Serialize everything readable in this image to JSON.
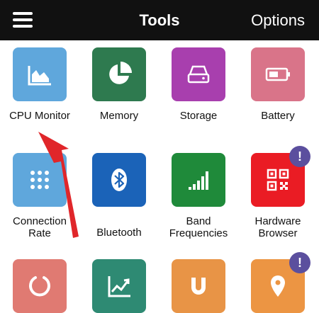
{
  "topbar": {
    "title": "Tools",
    "options_label": "Options"
  },
  "colors": {
    "topbar_bg": "#111111",
    "badge": "#5b4f9e",
    "arrow": "#e0262a"
  },
  "tiles": [
    {
      "label": "CPU Monitor",
      "icon": "area-chart-icon",
      "color": "#5fa7dc",
      "badge": ""
    },
    {
      "label": "Memory",
      "icon": "pie-chart-icon",
      "color": "#2e7a4f",
      "badge": ""
    },
    {
      "label": "Storage",
      "icon": "hard-drive-icon",
      "color": "#a83fae",
      "badge": ""
    },
    {
      "label": "Battery",
      "icon": "battery-icon",
      "color": "#d97489",
      "badge": ""
    },
    {
      "label": "Connection\nRate",
      "icon": "dots-grid-icon",
      "color": "#5fa7dc",
      "badge": ""
    },
    {
      "label": "Bluetooth",
      "icon": "bluetooth-icon",
      "color": "#1b63b8",
      "badge": ""
    },
    {
      "label": "Band\nFrequencies",
      "icon": "signal-bars-icon",
      "color": "#1f8a3a",
      "badge": ""
    },
    {
      "label": "Hardware\nBrowser",
      "icon": "qr-code-icon",
      "color": "#ea1c24",
      "badge": "!"
    },
    {
      "label": "",
      "icon": "ring-icon",
      "color": "#e07a72",
      "badge": ""
    },
    {
      "label": "",
      "icon": "trend-chart-icon",
      "color": "#2e8a73",
      "badge": ""
    },
    {
      "label": "",
      "icon": "magnet-icon",
      "color": "#e89446",
      "badge": ""
    },
    {
      "label": "",
      "icon": "location-pin-icon",
      "color": "#ec9543",
      "badge": "!"
    }
  ]
}
